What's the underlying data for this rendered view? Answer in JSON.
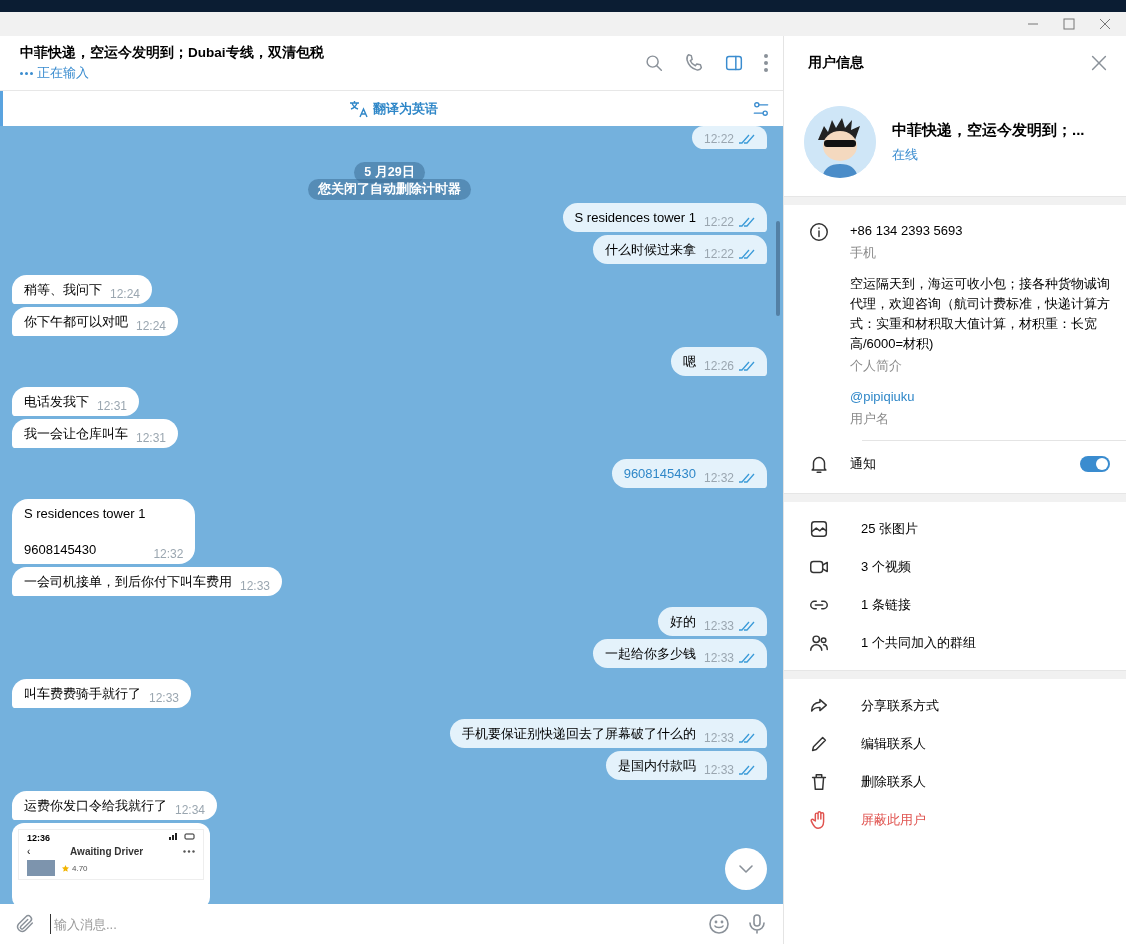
{
  "chat": {
    "title": "中菲快递，空运今发明到；Dubai专线，双清包税",
    "status": "正在输入",
    "translate": "翻译为英语",
    "date": "5 月29日",
    "service": "您关闭了自动删除计时器",
    "messages": [
      {
        "outgoing": true,
        "kind": "text",
        "time": "12:22",
        "read": true
      },
      {
        "outgoing": true,
        "kind": "text",
        "text": "S residences tower 1",
        "time": "12:22",
        "read": true
      },
      {
        "outgoing": true,
        "kind": "text",
        "text": "什么时候过来拿",
        "time": "12:22",
        "read": true
      },
      {
        "outgoing": false,
        "kind": "text",
        "text": "稍等、我问下",
        "time": "12:24"
      },
      {
        "outgoing": false,
        "kind": "text",
        "text": "你下午都可以对吧",
        "time": "12:24"
      },
      {
        "outgoing": true,
        "kind": "text",
        "text": "嗯",
        "time": "12:26",
        "read": true
      },
      {
        "outgoing": false,
        "kind": "text",
        "text": "电话发我下",
        "time": "12:31"
      },
      {
        "outgoing": false,
        "kind": "text",
        "text": "我一会让仓库叫车",
        "time": "12:31"
      },
      {
        "outgoing": true,
        "kind": "phone",
        "text": "9608145430",
        "time": "12:32",
        "read": true
      },
      {
        "outgoing": false,
        "kind": "text",
        "text": "S residences tower 1\n\n9608145430",
        "time": "12:32"
      },
      {
        "outgoing": false,
        "kind": "text",
        "text": "一会司机接单，到后你付下叫车费用",
        "time": "12:33"
      },
      {
        "outgoing": true,
        "kind": "text",
        "text": "好的",
        "time": "12:33",
        "read": true
      },
      {
        "outgoing": true,
        "kind": "text",
        "text": "一起给你多少钱",
        "time": "12:33",
        "read": true
      },
      {
        "outgoing": false,
        "kind": "text",
        "text": "叫车费费骑手就行了",
        "time": "12:33"
      },
      {
        "outgoing": true,
        "kind": "text",
        "text": "手机要保证别快递回去了屏幕破了什么的",
        "time": "12:33",
        "read": true
      },
      {
        "outgoing": true,
        "kind": "text",
        "text": "是国内付款吗",
        "time": "12:33",
        "read": true
      },
      {
        "outgoing": false,
        "kind": "text",
        "text": "运费你发口令给我就行了",
        "time": "12:34"
      },
      {
        "outgoing": false,
        "kind": "image",
        "shot": {
          "clock": "12:36",
          "title": "Awaiting Driver",
          "back": "‹",
          "rating": "4.70"
        }
      }
    ],
    "input": {
      "placeholder": "输入消息..."
    }
  },
  "profile_panel": {
    "title": "用户信息",
    "name": "中菲快递，空运今发明到；...",
    "status": "在线",
    "info": [
      {
        "kind": "phone",
        "value": "+86 134 2393 5693",
        "label": "手机"
      },
      {
        "kind": "bio",
        "value": "空运隔天到，海运可收小包；接各种货物诚询代理，欢迎咨询（航司计费标准，快递计算方式：实重和材积取大值计算，材积重：长宽高/6000=材积)",
        "label": "个人简介"
      },
      {
        "kind": "username",
        "value": "@pipiqiuku",
        "label": "用户名"
      }
    ],
    "notifications": {
      "label": "通知",
      "on": true
    },
    "media": [
      {
        "kind": "photos",
        "label": "25 张图片"
      },
      {
        "kind": "videos",
        "label": "3 个视频"
      },
      {
        "kind": "links",
        "label": "1 条链接"
      },
      {
        "kind": "groups",
        "label": "1 个共同加入的群组"
      }
    ],
    "actions": [
      {
        "kind": "share",
        "label": "分享联系方式",
        "danger": false
      },
      {
        "kind": "edit",
        "label": "编辑联系人",
        "danger": false
      },
      {
        "kind": "delete",
        "label": "删除联系人",
        "danger": false
      },
      {
        "kind": "block",
        "label": "屏蔽此用户",
        "danger": true
      }
    ]
  }
}
